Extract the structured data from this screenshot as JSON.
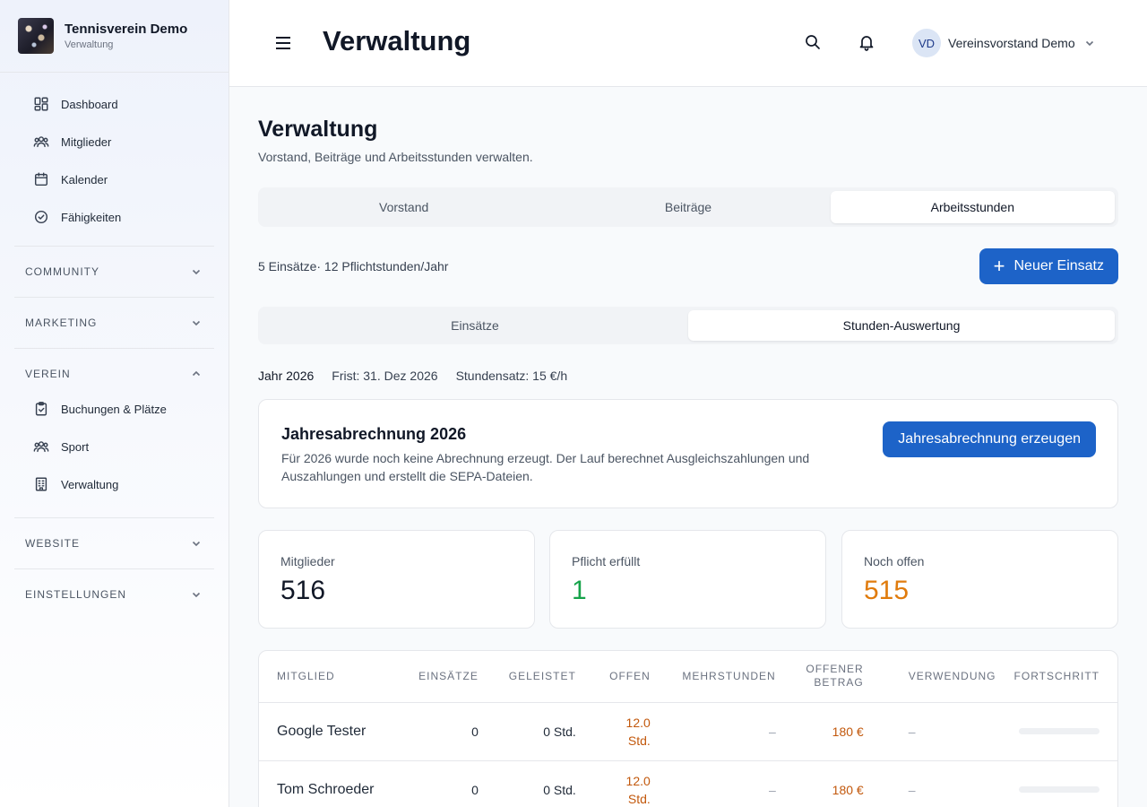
{
  "brand": {
    "title": "Tennisverein Demo",
    "subtitle": "Verwaltung"
  },
  "sidebar": {
    "items": [
      {
        "label": "Dashboard",
        "icon": "dashboard-icon"
      },
      {
        "label": "Mitglieder",
        "icon": "users-icon"
      },
      {
        "label": "Kalender",
        "icon": "calendar-icon"
      },
      {
        "label": "Fähigkeiten",
        "icon": "check-circle-icon"
      }
    ],
    "sections": {
      "community": "COMMUNITY",
      "marketing": "MARKETING",
      "verein": "VEREIN",
      "website": "WEBSITE",
      "einstellungen": "EINSTELLUNGEN"
    },
    "verein_items": [
      {
        "label": "Buchungen & Plätze",
        "icon": "clipboard-check-icon"
      },
      {
        "label": "Sport",
        "icon": "users-icon"
      },
      {
        "label": "Verwaltung",
        "icon": "building-icon"
      }
    ]
  },
  "header": {
    "title": "Verwaltung",
    "user_initials": "VD",
    "user_name": "Vereinsvorstand Demo"
  },
  "page": {
    "title": "Verwaltung",
    "subtitle": "Vorstand, Beiträge und Arbeitsstunden verwalten.",
    "tabs": [
      "Vorstand",
      "Beiträge",
      "Arbeitsstunden"
    ],
    "active_tab": "Arbeitsstunden",
    "summary": "5 Einsätze· 12 Pflichtstunden/Jahr",
    "new_button": "Neuer Einsatz",
    "subtabs": [
      "Einsätze",
      "Stunden-Auswertung"
    ],
    "active_subtab": "Stunden-Auswertung",
    "year": "Jahr 2026",
    "deadline": "Frist: 31. Dez 2026",
    "rate": "Stundensatz: 15 €/h"
  },
  "settlement": {
    "title": "Jahresabrechnung 2026",
    "text": "Für 2026 wurde noch keine Abrechnung erzeugt. Der Lauf berechnet Ausgleichszahlungen und Auszahlungen und erstellt die SEPA-Dateien.",
    "button": "Jahresabrechnung erzeugen"
  },
  "stats": [
    {
      "label": "Mitglieder",
      "value": "516"
    },
    {
      "label": "Pflicht erfüllt",
      "value": "1"
    },
    {
      "label": "Noch offen",
      "value": "515"
    }
  ],
  "table": {
    "headers": [
      "MITGLIED",
      "EINSÄTZE",
      "GELEISTET",
      "OFFEN",
      "MEHRSTUNDEN",
      "OFFENER BETRAG",
      "VERWENDUNG",
      "FORTSCHRITT"
    ],
    "rows": [
      {
        "name": "Google Tester",
        "einsaetze": "0",
        "geleistet": "0 Std.",
        "offen_value": "12.0",
        "offen_unit": "Std.",
        "mehrstunden": "–",
        "betrag": "180 €",
        "verwendung": "–",
        "progress": 0
      },
      {
        "name": "Tom Schroeder",
        "einsaetze": "0",
        "geleistet": "0 Std.",
        "offen_value": "12.0",
        "offen_unit": "Std.",
        "mehrstunden": "–",
        "betrag": "180 €",
        "verwendung": "–",
        "progress": 0
      }
    ]
  },
  "colors": {
    "primary": "#1d63c8",
    "success": "#16a34a",
    "warning": "#e07b0c",
    "amount": "#c2580c"
  }
}
